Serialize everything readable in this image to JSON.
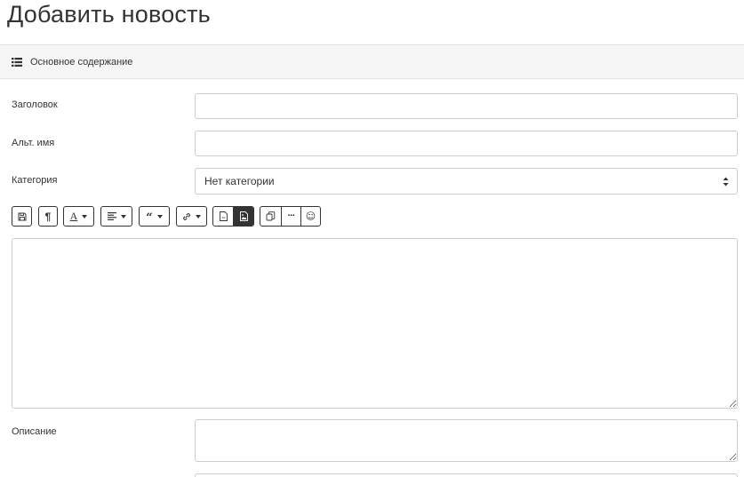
{
  "page": {
    "title": "Добавить новость"
  },
  "section": {
    "title": "Основное содержание",
    "icon": "list-icon"
  },
  "form": {
    "title_label": "Заголовок",
    "title_value": "",
    "alias_label": "Альт. имя",
    "alias_value": "",
    "category_label": "Категория",
    "category_value": "Нет категории",
    "description_label": "Описание",
    "description_value": ""
  },
  "toolbar": {
    "buttons": [
      {
        "icon": "save-icon"
      },
      {
        "icon": "paragraph-icon",
        "glyph": "¶"
      },
      {
        "icon": "font-color-icon",
        "glyph": "A"
      },
      {
        "icon": "align-icon"
      },
      {
        "icon": "quote-icon",
        "glyph": "“"
      },
      {
        "icon": "link-icon"
      },
      {
        "icon": "document-icon"
      },
      {
        "icon": "image-icon"
      },
      {
        "icon": "copy-icon"
      },
      {
        "icon": "more-icon",
        "glyph": "···"
      },
      {
        "icon": "smiley-icon",
        "glyph": "☺"
      }
    ]
  },
  "colors": {
    "accent": "#333333",
    "section_bg": "#f5f5f5",
    "border": "#cccccc"
  }
}
